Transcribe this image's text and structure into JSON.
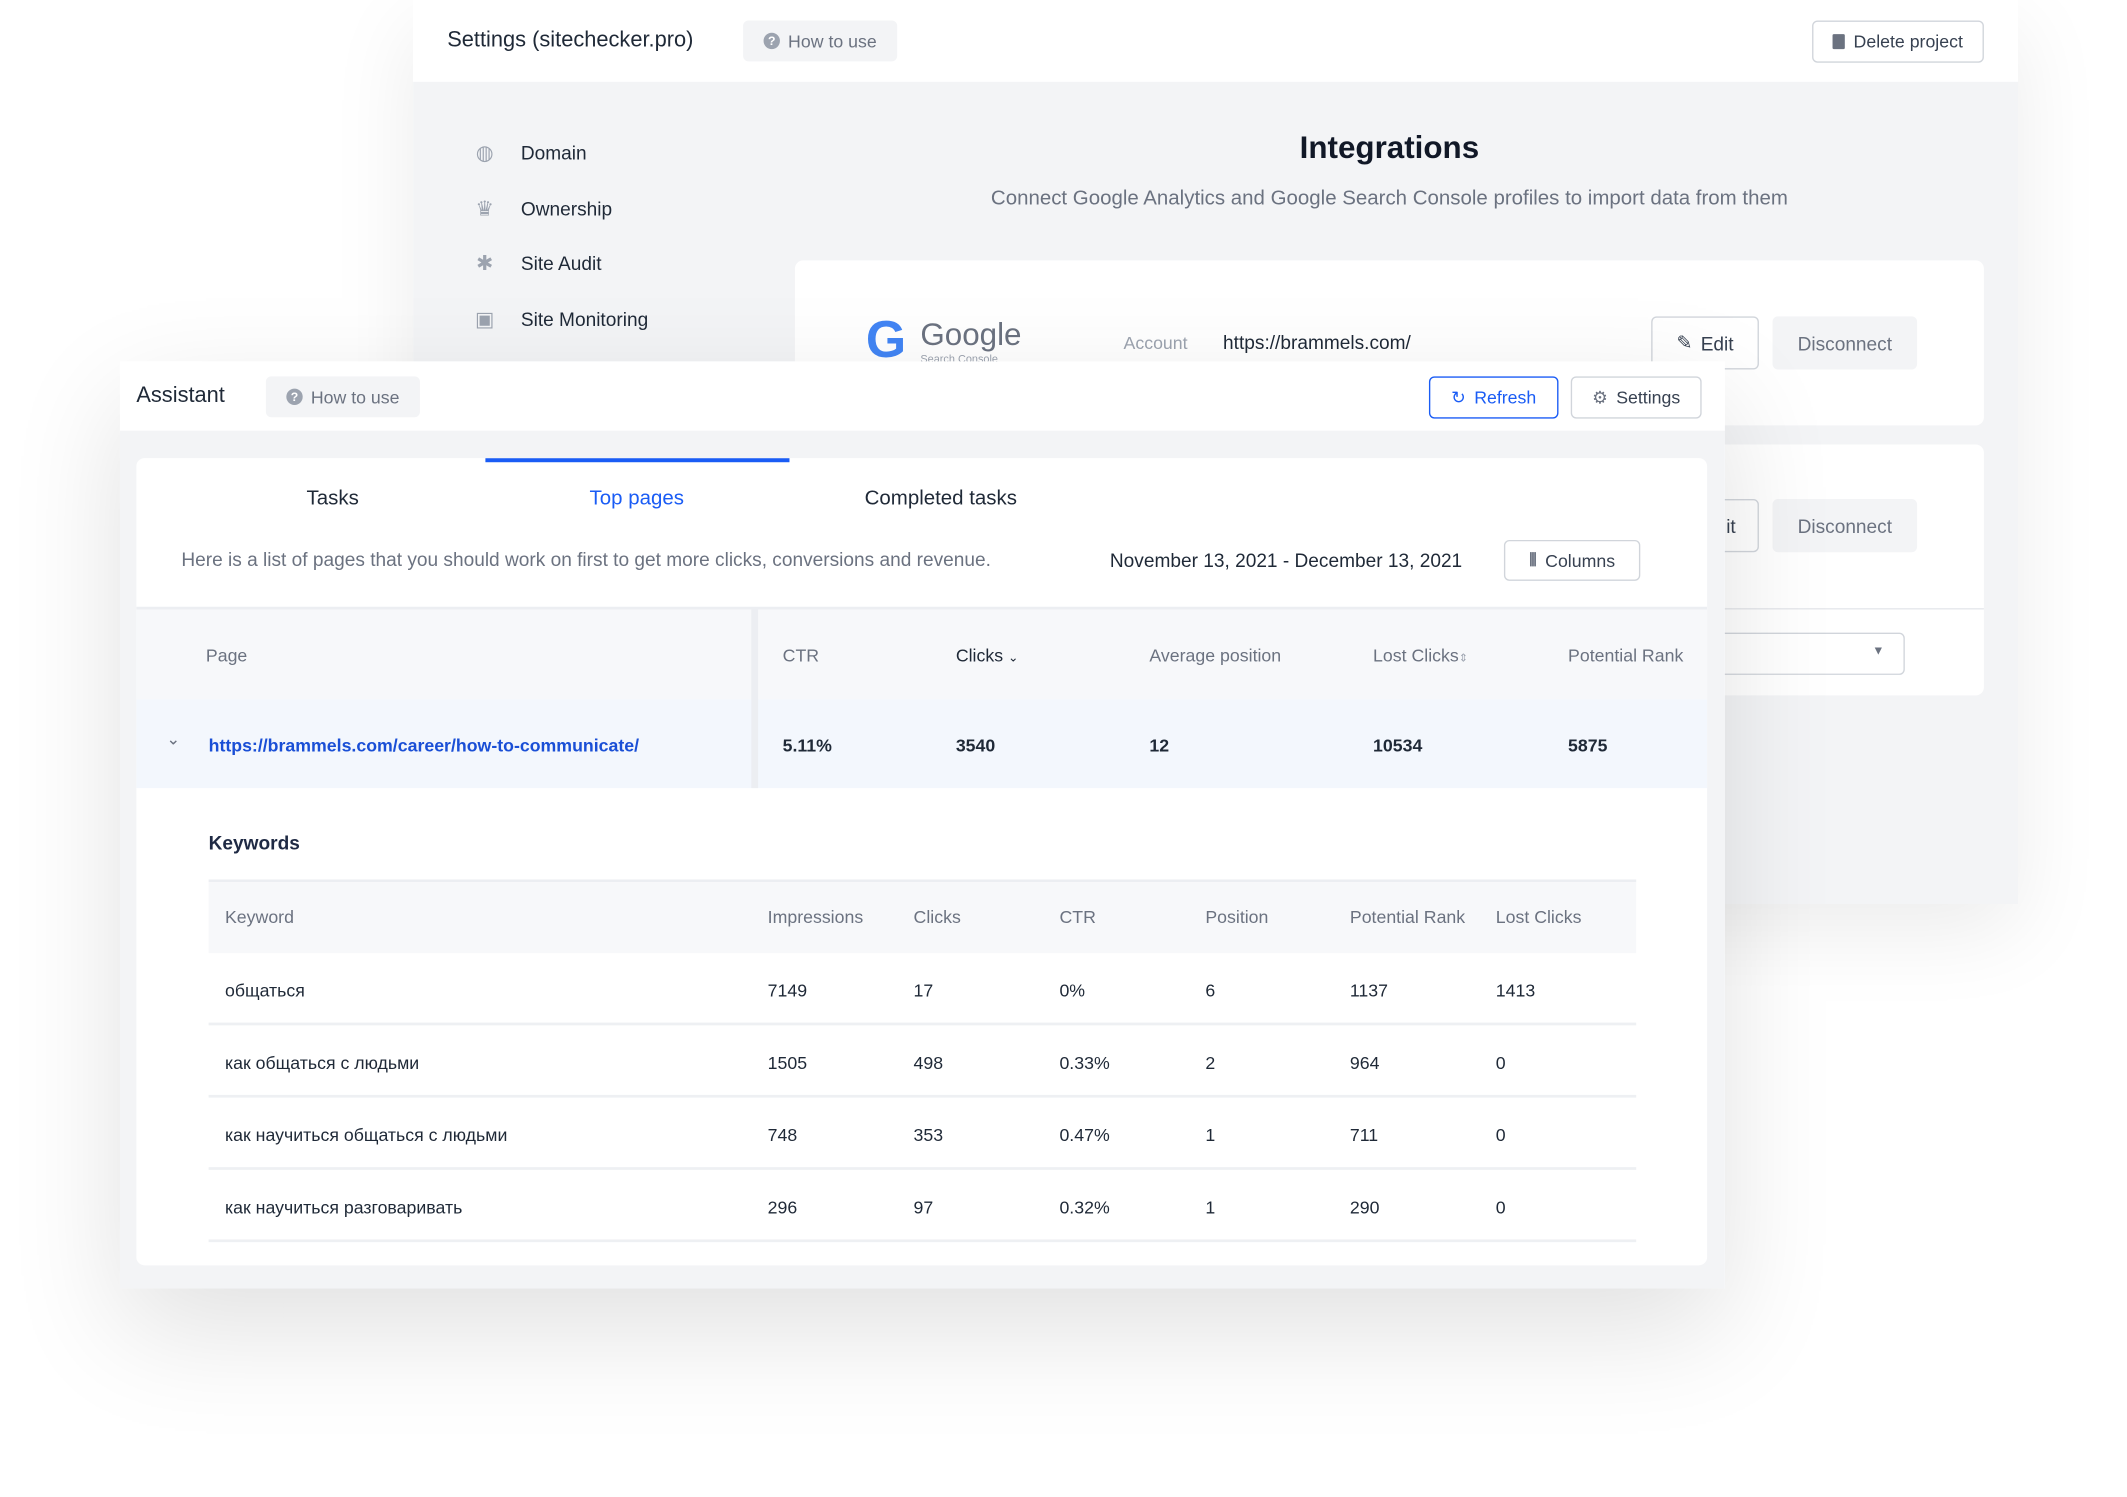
{
  "settings": {
    "title": "Settings (sitechecker.pro)",
    "how_to_use": "How to use",
    "delete_project": "Delete project",
    "sidebar": [
      {
        "label": "Domain",
        "icon": "globe-icon"
      },
      {
        "label": "Ownership",
        "icon": "crown-icon"
      },
      {
        "label": "Site Audit",
        "icon": "bug-icon"
      },
      {
        "label": "Site Monitoring",
        "icon": "monitor-search-icon"
      }
    ],
    "integrations_title": "Integrations",
    "integrations_subtitle": "Connect Google Analytics and Google Search Console profiles to import data from them",
    "google_card": {
      "logo_text": "Google",
      "logo_sub": "Search Console",
      "account_label": "Account",
      "account_value": "https://brammels.com/",
      "edit": "Edit",
      "disconnect": "Disconnect"
    },
    "second_card": {
      "edit_partial": "it",
      "disconnect": "Disconnect"
    }
  },
  "assistant": {
    "title": "Assistant",
    "how_to_use": "How to use",
    "refresh": "Refresh",
    "settings": "Settings",
    "tabs": [
      {
        "label": "Tasks",
        "active": false
      },
      {
        "label": "Top pages",
        "active": true
      },
      {
        "label": "Completed tasks",
        "active": false
      }
    ],
    "description": "Here is a list of pages that you should work on first to get more clicks, conversions and revenue.",
    "date_range": "November 13, 2021 - December 13, 2021",
    "columns_button": "Columns",
    "table": {
      "headers": [
        "Page",
        "CTR",
        "Clicks",
        "Average position",
        "Lost Clicks",
        "Potential Rank"
      ],
      "sorted_column": "Clicks",
      "row": {
        "page": "https://brammels.com/career/how-to-communicate/",
        "ctr": "5.11%",
        "clicks": "3540",
        "avg_position": "12",
        "lost_clicks": "10534",
        "potential_rank": "5875"
      }
    },
    "keywords": {
      "title": "Keywords",
      "headers": [
        "Keyword",
        "Impressions",
        "Clicks",
        "CTR",
        "Position",
        "Potential Rank",
        "Lost Clicks"
      ],
      "rows": [
        [
          "общаться",
          "7149",
          "17",
          "0%",
          "6",
          "1137",
          "1413"
        ],
        [
          "как общаться с людьми",
          "1505",
          "498",
          "0.33%",
          "2",
          "964",
          "0"
        ],
        [
          "как научиться общаться с людьми",
          "748",
          "353",
          "0.47%",
          "1",
          "711",
          "0"
        ],
        [
          "как научиться разговаривать",
          "296",
          "97",
          "0.32%",
          "1",
          "290",
          "0"
        ]
      ]
    }
  },
  "colors": {
    "accent": "#1a5cf5",
    "link": "#1a4fd6",
    "background": "#f3f4f6"
  }
}
